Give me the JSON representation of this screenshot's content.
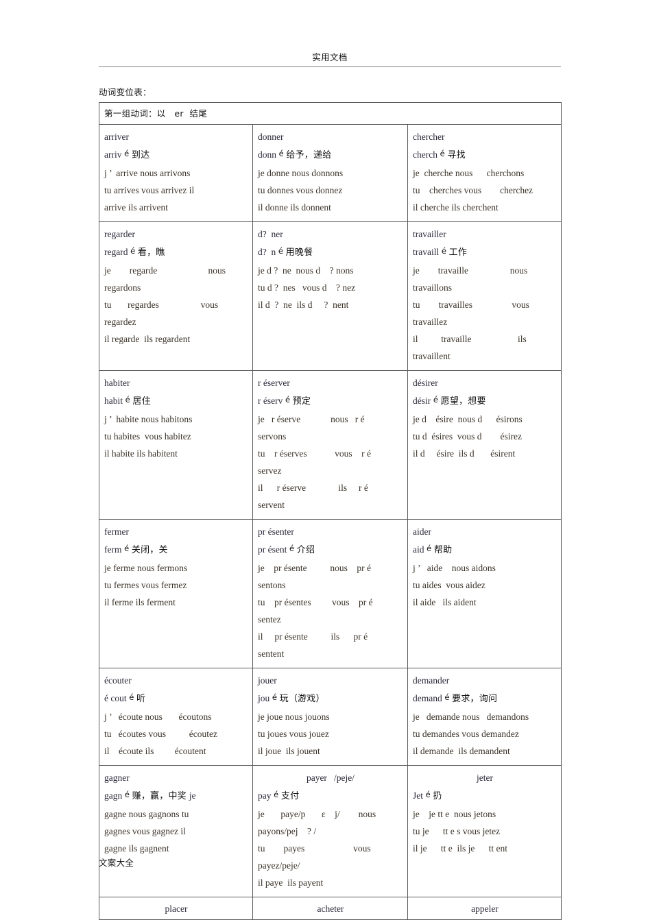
{
  "header": {
    "running_head": "实用文档"
  },
  "footer": {
    "running_foot": "文案大全"
  },
  "section": {
    "title": "动词变位表："
  },
  "table": {
    "banner": "第一组动词：以   er  结尾",
    "rows": [
      {
        "cells": [
          {
            "infinitive": "arriver",
            "gloss_stem": "arriv",
            "gloss_cjk": "到达",
            "forms": [
              "j ’  arrive nous arrivons",
              "tu arrives vous arrivez il",
              "arrive ils arrivent"
            ]
          },
          {
            "infinitive": "donner",
            "gloss_stem": "donn",
            "gloss_cjk": "给予，递给",
            "forms": [
              "je donne nous donnons",
              "tu donnes vous donnez",
              "il donne ils donnent"
            ]
          },
          {
            "infinitive": "chercher",
            "gloss_stem": "cherch",
            "gloss_cjk": "寻找",
            "forms": [
              "je  cherche nous      cherchons",
              "tu    cherches vous        cherchez",
              "il cherche ils cherchent"
            ]
          }
        ]
      },
      {
        "cells": [
          {
            "infinitive": "regarder",
            "gloss_stem": "regard",
            "gloss_cjk": "看，瞧",
            "forms": [
              "je        regarde                      nous",
              "regardons",
              "tu       regardes                  vous",
              "regardez",
              "il regarde  ils regardent"
            ]
          },
          {
            "infinitive": "d?  ner",
            "gloss_stem": "d?  n",
            "gloss_cjk": "用晚餐",
            "forms": [
              "je d ?  ne  nous d    ? nons",
              "tu d ?  nes   vous d    ? nez",
              "il d  ?  ne  ils d     ?  nent"
            ]
          },
          {
            "infinitive": "travailler",
            "gloss_stem": "travaill",
            "gloss_cjk": "工作",
            "forms": [
              "je        travaille                  nous",
              "travaillons",
              "tu        travailles                 vous",
              "travaillez",
              "il          travaille                    ils",
              "travaillent"
            ]
          }
        ]
      },
      {
        "cells": [
          {
            "infinitive": "habiter",
            "gloss_stem": "habit",
            "gloss_cjk": "居住",
            "forms": [
              "j ’  habite nous habitons",
              "tu habites  vous habitez",
              "il habite ils habitent"
            ]
          },
          {
            "infinitive": "r éserver",
            "gloss_stem": "r éserv",
            "gloss_cjk": "预定",
            "forms": [
              "je   r éserve             nous   r é",
              "servons",
              "tu    r éserves            vous    r é",
              "servez",
              "il      r éserve              ils     r é",
              "servent"
            ]
          },
          {
            "infinitive": "désirer",
            "gloss_stem": "désir",
            "gloss_cjk": "愿望，想要",
            "forms": [
              "je d    ésire  nous d      ésirons",
              "tu d  ésires  vous d        ésirez",
              "il d     ésire  ils d       ésirent"
            ]
          }
        ]
      },
      {
        "cells": [
          {
            "infinitive": "fermer",
            "gloss_stem": "ferm",
            "gloss_cjk": "关闭，关",
            "forms": [
              "je ferme nous fermons",
              "tu fermes vous fermez",
              "il ferme ils ferment"
            ]
          },
          {
            "infinitive": "pr ésenter",
            "gloss_stem": "pr ésent",
            "gloss_cjk": "介绍",
            "forms": [
              "je    pr ésente          nous    pr é",
              "sentons",
              "tu    pr ésentes         vous    pr é",
              "sentez",
              "il     pr ésente          ils      pr é",
              "sentent"
            ]
          },
          {
            "infinitive": "aider",
            "gloss_stem": "aid",
            "gloss_cjk": "帮助",
            "forms": [
              "j ’   aide    nous aidons",
              "tu aides  vous aidez",
              "il aide   ils aident"
            ]
          }
        ]
      },
      {
        "cells": [
          {
            "infinitive": "écouter",
            "gloss_stem": "é cout",
            "gloss_cjk": "听",
            "forms": [
              "j ’   écoute nous       écoutons",
              "tu   écoutes vous          écoutez",
              "il    écoute ils         écoutent"
            ]
          },
          {
            "infinitive": "jouer",
            "gloss_stem": "jou",
            "gloss_cjk": "玩（游戏）",
            "forms": [
              "je joue nous jouons",
              "tu joues vous jouez",
              "il joue  ils jouent"
            ]
          },
          {
            "infinitive": "demander",
            "gloss_stem": "demand",
            "gloss_cjk": "要求，询问",
            "forms": [
              "je   demande nous   demandons",
              "tu demandes vous demandez",
              "il demande  ils demandent"
            ]
          }
        ]
      },
      {
        "cells": [
          {
            "infinitive": "gagner",
            "gloss_stem": "gagn",
            "gloss_cjk": "赚，赢，中奖",
            "gloss_tail": "je",
            "forms": [
              "gagne nous gagnons tu",
              "gagnes vous gagnez il",
              "gagne ils gagnent"
            ]
          },
          {
            "infinitive": "payer   /peje/",
            "infinitive_centered": true,
            "gloss_stem": "pay",
            "gloss_cjk": "支付",
            "forms": [
              "je       paye/p       ε    j/        nous",
              "payons/pej    ? /",
              "tu        payes                     vous",
              "payez/peje/",
              "il paye  ils payent"
            ]
          },
          {
            "infinitive": "jeter",
            "infinitive_centered": true,
            "gloss_stem": "Jet",
            "gloss_cjk": "扔",
            "forms": [
              "je    je tt e  nous jetons",
              "tu je      tt e s vous jetez",
              "il je      tt e  ils je      tt ent"
            ]
          }
        ]
      },
      {
        "last": true,
        "cells": [
          {
            "infinitive": "placer",
            "infinitive_centered": true
          },
          {
            "infinitive": "acheter",
            "infinitive_centered": true
          },
          {
            "infinitive": "appeler",
            "infinitive_centered": true
          }
        ]
      }
    ]
  }
}
